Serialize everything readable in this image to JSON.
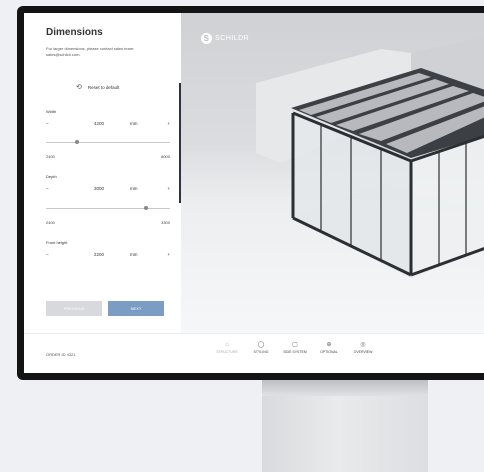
{
  "panel": {
    "title": "Dimensions",
    "note": "For larger dimensions, please contact sales team: sales@schildr.com.",
    "reset_label": "Reset to default",
    "fields": [
      {
        "label": "Width",
        "value": "4200",
        "unit": "mm",
        "minus": "–",
        "plus": "+",
        "min": "2400",
        "max": "8000"
      },
      {
        "label": "Depth",
        "value": "3000",
        "unit": "mm",
        "minus": "–",
        "plus": "+",
        "min": "2400",
        "max": "3300"
      },
      {
        "label": "Front height",
        "value": "2200",
        "unit": "mm",
        "minus": "–",
        "plus": "+"
      }
    ],
    "prev_label": "PREVIOUS",
    "next_label": "NEXT"
  },
  "brand": {
    "logo_letter": "S",
    "name": "SCHILDR"
  },
  "bottombar": {
    "order_label": "ORDER ID 4321",
    "steps": [
      {
        "label": "STRUCTURE",
        "icon": "structure-icon"
      },
      {
        "label": "STYLING",
        "icon": "styling-icon"
      },
      {
        "label": "SIDE SYSTEM",
        "icon": "side-system-icon"
      },
      {
        "label": "OPTIONAL",
        "icon": "optional-icon"
      },
      {
        "label": "OVERVIEW",
        "icon": "overview-icon"
      }
    ]
  },
  "colors": {
    "accent": "#7b9dc4",
    "frame": "#2b2f33",
    "bezel": "#141414"
  }
}
